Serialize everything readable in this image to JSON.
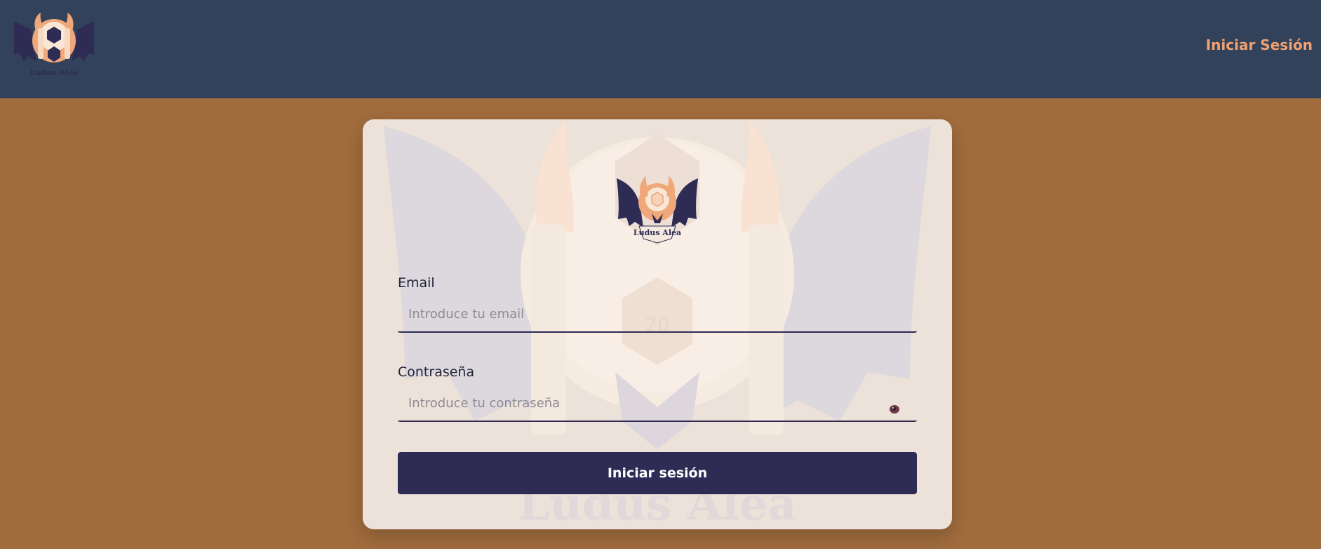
{
  "navbar": {
    "logo_icon": "ludus-alea-bat-logo-icon",
    "logo_text": "Ludus Alea",
    "login_link": "Iniciar Sesión"
  },
  "card": {
    "logo_icon": "ludus-alea-bat-logo-icon",
    "logo_text": "Ludus Alea",
    "watermark_text": "Ludus Alea",
    "die_number": "20",
    "email_label": "Email",
    "email_placeholder": "Introduce tu email",
    "password_label": "Contraseña",
    "password_placeholder": "Introduce tu contraseña",
    "eye_icon": "eye-icon",
    "submit_label": "Iniciar sesión"
  },
  "colors": {
    "navbar": "#32425a",
    "page_background": "#a26d3d",
    "card_background": "#ece2d9",
    "accent": "#f2a172",
    "primary": "#2e2c54"
  }
}
